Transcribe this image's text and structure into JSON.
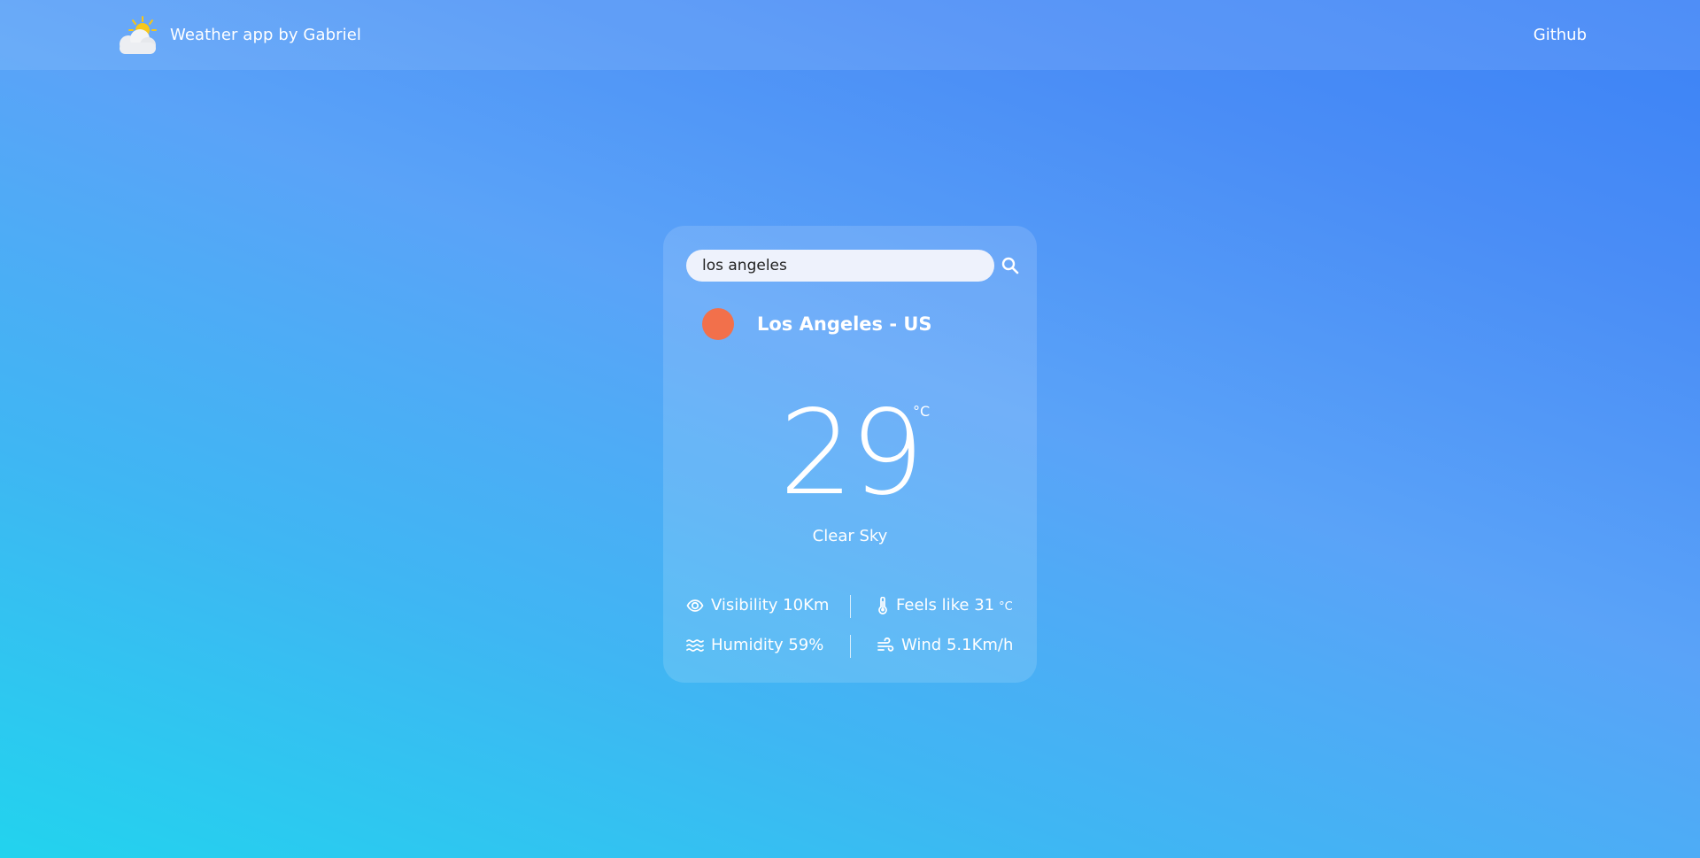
{
  "header": {
    "brand_title": "Weather app by Gabriel",
    "logo_icon": "partly-sunny-icon",
    "github_label": "Github"
  },
  "search": {
    "value": "los angeles",
    "icon": "search-icon"
  },
  "location": {
    "name": "Los Angeles - US",
    "weather_indicator_color": "#f2704b"
  },
  "current": {
    "temperature": "29",
    "unit": "°C",
    "condition": "Clear Sky"
  },
  "metrics": {
    "visibility": {
      "icon": "eye-icon",
      "label": "Visibility 10Km"
    },
    "feels_like": {
      "icon": "thermometer-icon",
      "label": "Feels like 31",
      "unit": "°C"
    },
    "humidity": {
      "icon": "humidity-icon",
      "label": "Humidity 59%"
    },
    "wind": {
      "icon": "wind-icon",
      "label": "Wind 5.1Km/h"
    }
  },
  "colors": {
    "gradient_start": "#22d3ee",
    "gradient_end": "#3b82f6",
    "accent_dot": "#f2704b"
  }
}
